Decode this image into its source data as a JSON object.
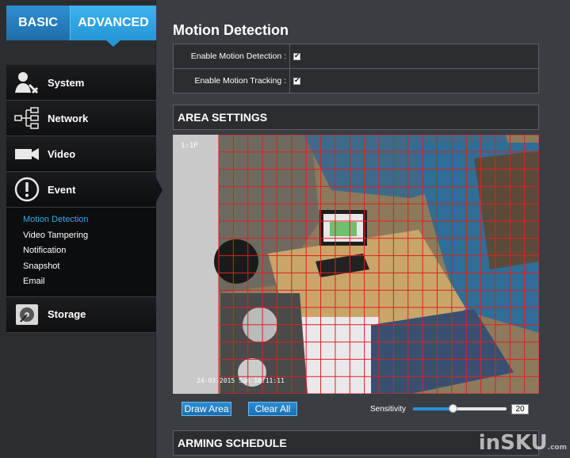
{
  "tabs": {
    "basic": "BASIC",
    "advanced": "ADVANCED"
  },
  "menu": {
    "system": "System",
    "network": "Network",
    "video": "Video",
    "event": "Event",
    "storage": "Storage",
    "event_sub": [
      "Motion Detection",
      "Video Tampering",
      "Notification",
      "Snapshot",
      "Email"
    ],
    "selected_sub": "Motion Detection"
  },
  "page": {
    "title": "Motion Detection",
    "enable_motion_label": "Enable Motion Detection :",
    "enable_motion_checked": true,
    "enable_tracking_label": "Enable Motion Tracking :",
    "enable_tracking_checked": true
  },
  "area": {
    "title": "AREA SETTINGS",
    "overlay_top": "1:1P",
    "overlay_timestamp": "24-03-2015 Sun 10:11:11",
    "draw_button": "Draw Area",
    "clear_button": "Clear All",
    "sensitivity_label": "Sensitivity",
    "sensitivity_value": "20",
    "sensitivity_fraction": 0.42,
    "grid_color": "#e0201e"
  },
  "arming": {
    "title": "ARMING SCHEDULE"
  },
  "watermark": {
    "text": "inSKU",
    "suffix": ".com"
  },
  "colors": {
    "accent": "#2596d5",
    "selected_text": "#3aa7e6"
  }
}
